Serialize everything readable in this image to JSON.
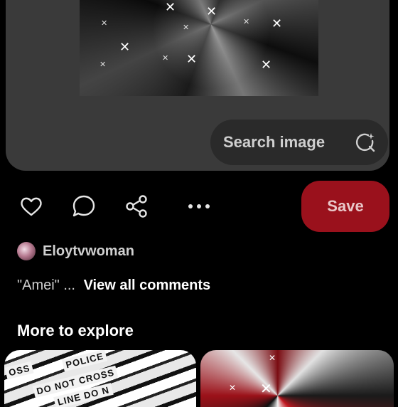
{
  "pin": {
    "search_label": "Search image"
  },
  "actions": {
    "save_label": "Save"
  },
  "creator": {
    "name": "Eloytvwoman"
  },
  "comments": {
    "snippet": "\"Amei\" ...",
    "view_all_label": "View all comments"
  },
  "explore": {
    "title": "More to explore",
    "thumb_1_tape": [
      "OSS",
      "POLICE",
      "DO NOT CROSS",
      "LINE DO N"
    ]
  },
  "icons": {
    "like": "heart-icon",
    "comment": "comment-bubble-icon",
    "share": "share-icon",
    "more": "more-dots-icon",
    "search_image": "sparkle-search-icon"
  },
  "colors": {
    "background": "#000000",
    "card": "#3a3a3a",
    "save_button": "#9a111c",
    "search_pill": "#2a2a2a"
  }
}
